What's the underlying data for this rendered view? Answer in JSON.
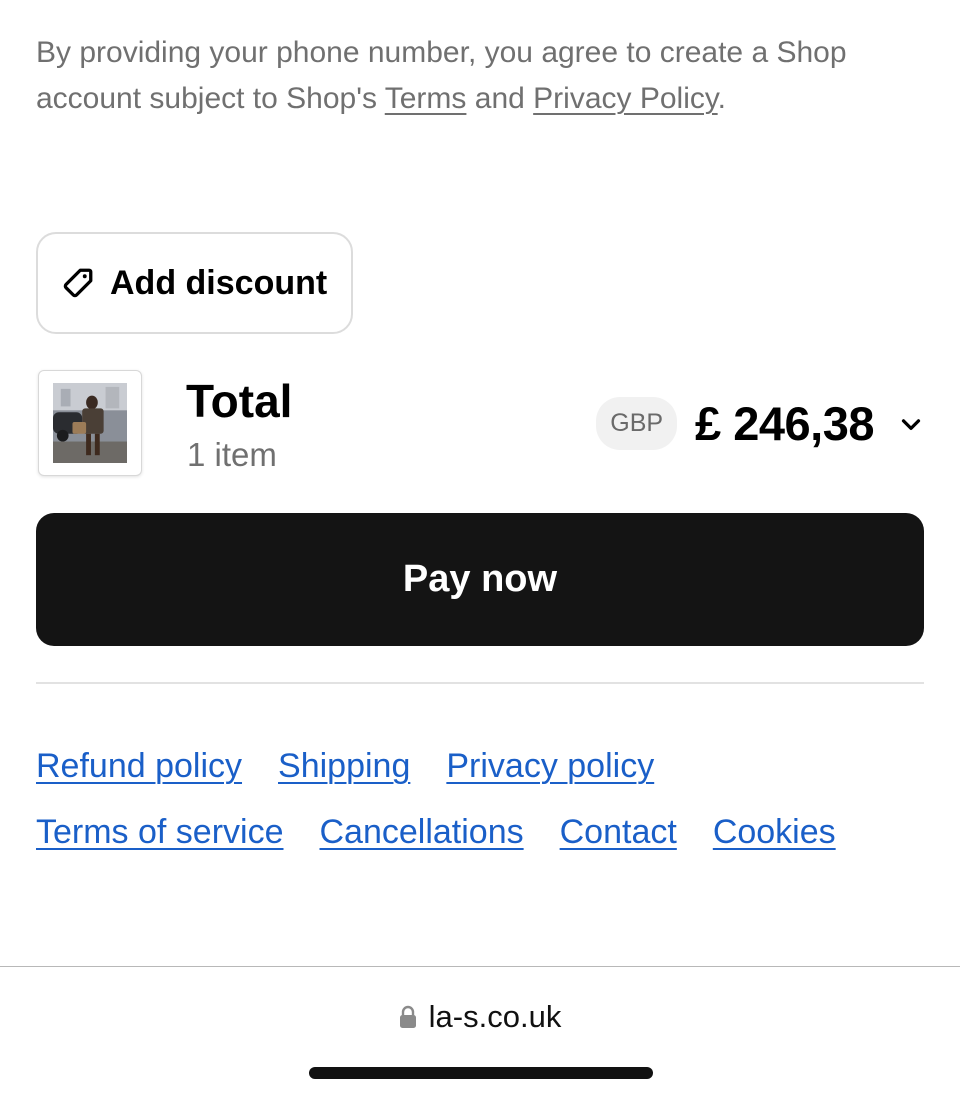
{
  "consent": {
    "text_before": "By providing your phone number, you agree to create a Shop account subject to Shop's ",
    "terms_link": "Terms",
    "text_between": " and ",
    "privacy_link": "Privacy Policy",
    "text_after": "."
  },
  "discount": {
    "label": "Add discount",
    "icon": "tag-icon"
  },
  "order": {
    "total_label": "Total",
    "item_count": "1 item",
    "currency": "GBP",
    "amount": "£ 246,38",
    "thumbnail_icon": "product-thumbnail"
  },
  "pay_button": {
    "label": "Pay now"
  },
  "footer_links": {
    "row1": [
      "Refund policy",
      "Shipping",
      "Privacy policy"
    ],
    "row2": [
      "Terms of service",
      "Cancellations",
      "Contact",
      "Cookies"
    ]
  },
  "browser": {
    "url": "la-s.co.uk",
    "lock_icon": "lock-icon"
  },
  "colors": {
    "link": "#1a5fc8",
    "pay_button": "#141414",
    "muted_text": "#707070"
  }
}
